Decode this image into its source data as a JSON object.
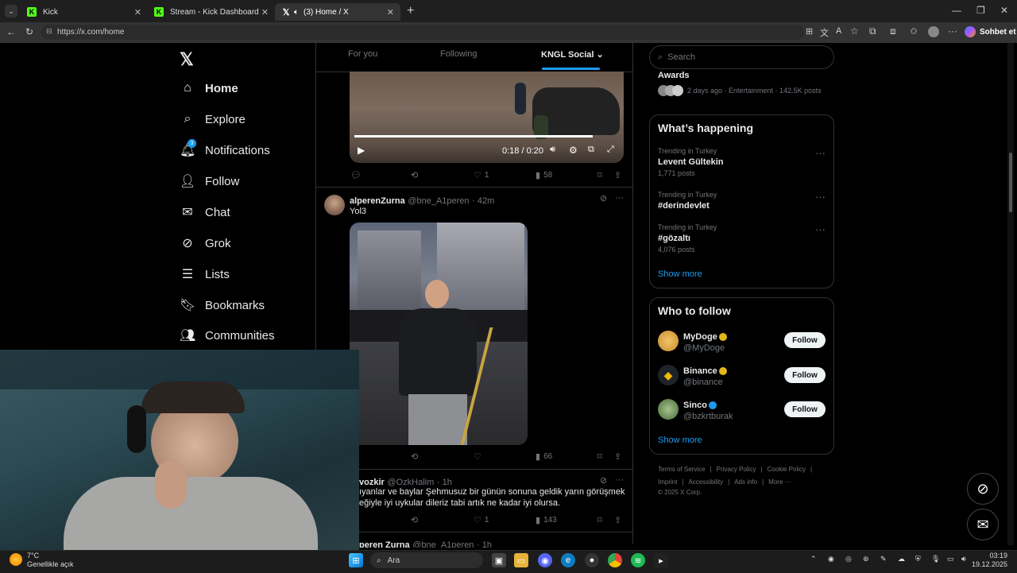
{
  "browser": {
    "tabs": [
      {
        "title": "Kick",
        "active": false
      },
      {
        "title": "Stream - Kick Dashboard",
        "active": false
      },
      {
        "title": "(3) Home / X",
        "active": true
      }
    ],
    "url": "https://x.com/home",
    "copilot_label": "Sohbet et"
  },
  "nav": {
    "items": [
      {
        "label": "Home",
        "icon": "home-icon"
      },
      {
        "label": "Explore",
        "icon": "search-icon"
      },
      {
        "label": "Notifications",
        "icon": "bell-icon",
        "badge": "3"
      },
      {
        "label": "Follow",
        "icon": "person-add-icon"
      },
      {
        "label": "Chat",
        "icon": "mail-icon"
      },
      {
        "label": "Grok",
        "icon": "grok-icon"
      },
      {
        "label": "Lists",
        "icon": "list-icon"
      },
      {
        "label": "Bookmarks",
        "icon": "bookmark-icon"
      },
      {
        "label": "Communities",
        "icon": "people-icon"
      }
    ]
  },
  "feed": {
    "tabs": [
      "For you",
      "Following",
      "KNGL Social"
    ],
    "video": {
      "time": "0:18 / 0:20"
    },
    "post1_actions": {
      "likes": "1",
      "views": "58"
    },
    "post2": {
      "name": "alperenZurna",
      "handle": "@bne_A1peren",
      "time": "· 42m",
      "text": "Yol3",
      "views": "66"
    },
    "post3": {
      "name": "vozkir",
      "handle": "@OzkHalim",
      "time": "· 1h",
      "text_line1": "ıyanlar ve baylar Şehmusuz bir günün sonuna geldik yarın görüşmek",
      "text_line2": "eğiyle iyi uykular dileriz tabi artık ne kadar iyi olursa.",
      "likes": "1",
      "views": "143"
    },
    "post4": {
      "name": "peren Zurna",
      "handle": "@bne_A1peren",
      "time": "· 1h"
    }
  },
  "sidebar": {
    "search_placeholder": "Search",
    "awards": {
      "title": "Awards",
      "meta": "2 days ago · Entertainment · 142.5K posts"
    },
    "happening": {
      "title": "What’s happening",
      "trends": [
        {
          "context": "Trending in Turkey",
          "name": "Levent Gültekin",
          "posts": "1,771 posts"
        },
        {
          "context": "Trending in Turkey",
          "name": "#derindevlet",
          "posts": ""
        },
        {
          "context": "Trending in Turkey",
          "name": "#gözaltı",
          "posts": "4,076 posts"
        }
      ],
      "show_more": "Show more"
    },
    "who_to_follow": {
      "title": "Who to follow",
      "accounts": [
        {
          "name": "MyDoge",
          "handle": "@MyDoge",
          "button": "Follow",
          "badge": "gold"
        },
        {
          "name": "Binance",
          "handle": "@binance",
          "button": "Follow",
          "badge": "gold"
        },
        {
          "name": "Sinco",
          "handle": "@bzkrtburak",
          "button": "Follow",
          "badge": "blue"
        }
      ],
      "show_more": "Show more"
    },
    "footer": {
      "row1": [
        "Terms of Service",
        "|",
        "Privacy Policy",
        "|",
        "Cookie Policy",
        "|"
      ],
      "row2": [
        "Imprint",
        "|",
        "Accessibility",
        "|",
        "Ads info",
        "|",
        "More ···"
      ],
      "copyright": "© 2025 X Corp."
    }
  },
  "taskbar": {
    "weather_temp": "7°C",
    "weather_desc": "Genellikle açık",
    "search_label": "Ara",
    "time": "03:19",
    "date": "19.12.2025"
  },
  "colors": {
    "accent": "#1d9bf0",
    "kick_green": "#53fc18",
    "background": "#000000"
  }
}
